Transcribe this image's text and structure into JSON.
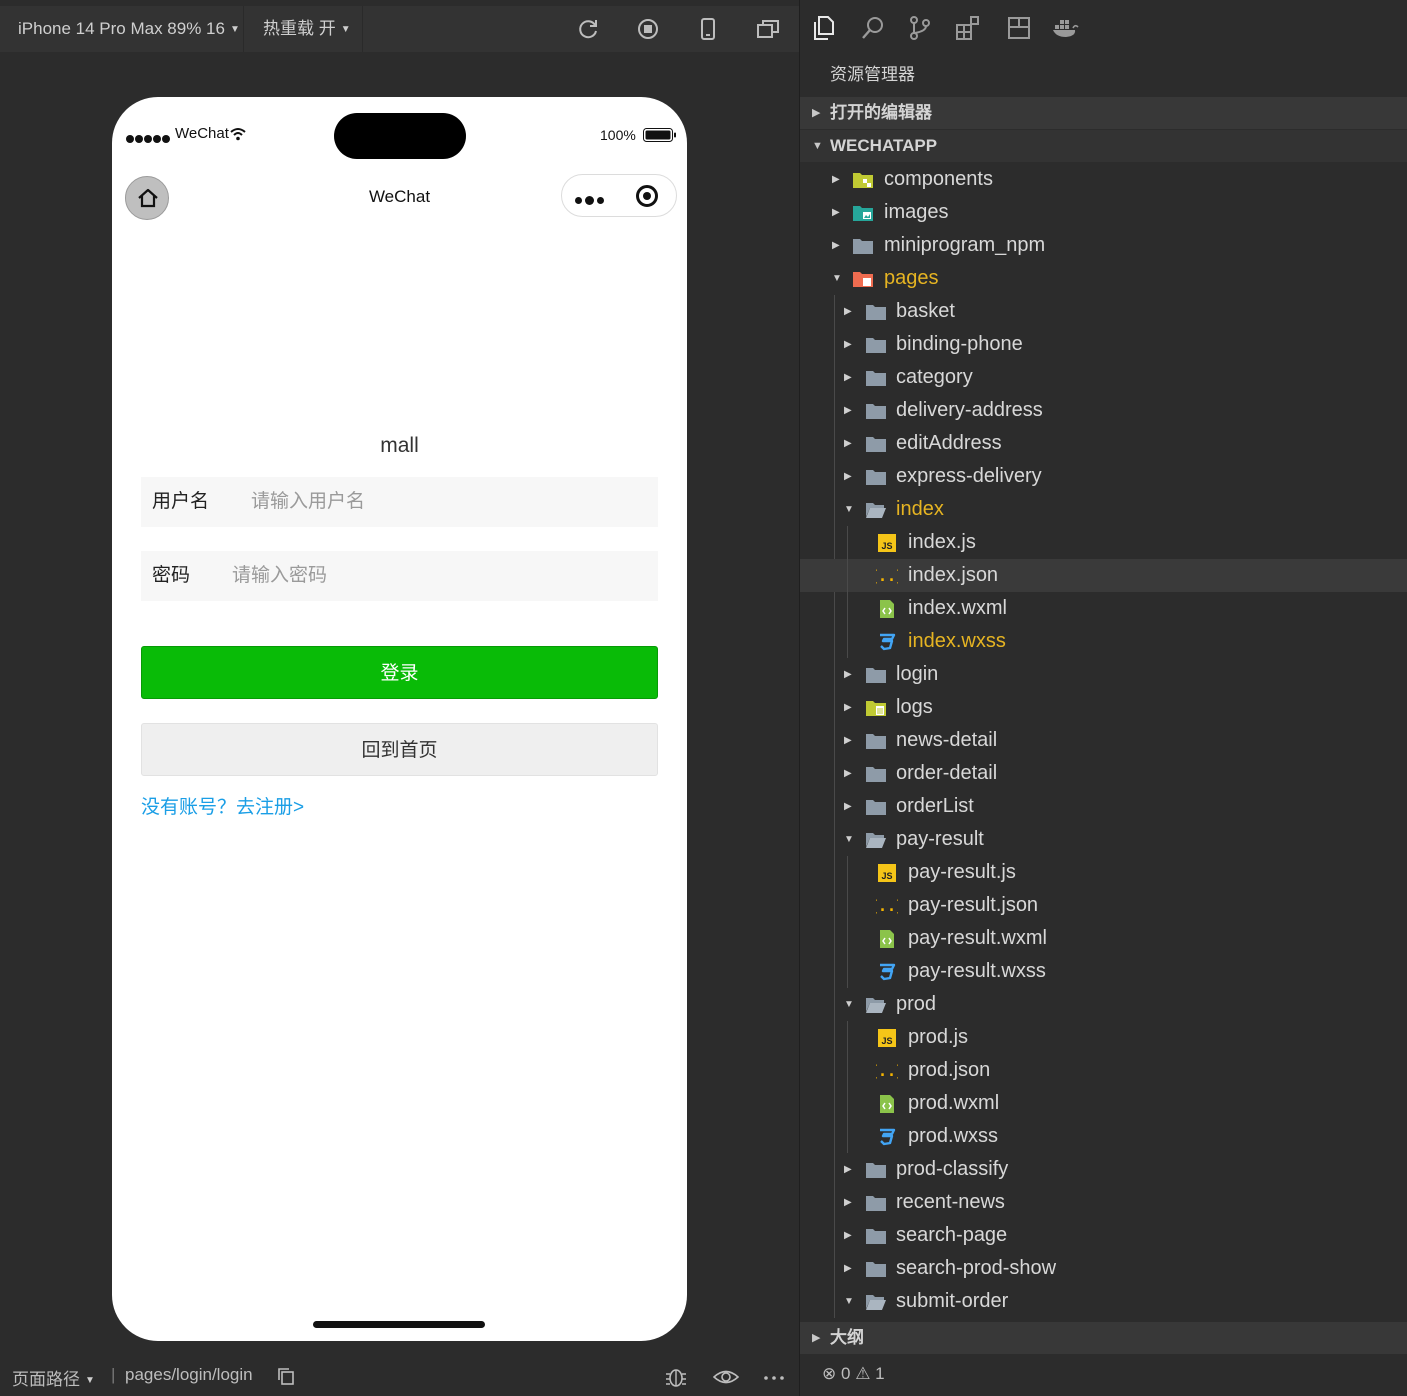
{
  "toolbar": {
    "device": "iPhone 14 Pro Max 89% 16",
    "hot_reload": "热重载 开",
    "icons": [
      "refresh-icon",
      "stop-icon",
      "device-icon",
      "detach-window-icon"
    ]
  },
  "phone": {
    "carrier": "WeChat",
    "battery": "100%",
    "nav_title": "WeChat",
    "app_title": "mall",
    "username_label": "用户名",
    "username_placeholder": "请输入用户名",
    "password_label": "密码",
    "password_placeholder": "请输入密码",
    "login_button": "登录",
    "home_button": "回到首页",
    "register_link": "没有账号？去注册>"
  },
  "bottombar": {
    "page_path_label": "页面路径",
    "separator": "|",
    "page_path": "pages/login/login"
  },
  "explorer": {
    "title": "资源管理器",
    "open_editors": "打开的编辑器",
    "project": "WECHATAPP",
    "outline": "大纲",
    "problems": {
      "errors": "0",
      "warnings": "1"
    },
    "tree": [
      {
        "label": "components",
        "depth": 0,
        "kind": "folder-components",
        "expanded": false
      },
      {
        "label": "images",
        "depth": 0,
        "kind": "folder-images",
        "expanded": false
      },
      {
        "label": "miniprogram_npm",
        "depth": 0,
        "kind": "folder",
        "expanded": false
      },
      {
        "label": "pages",
        "depth": 0,
        "kind": "folder-pages",
        "expanded": true,
        "highlight": true
      },
      {
        "label": "basket",
        "depth": 1,
        "kind": "folder",
        "expanded": false
      },
      {
        "label": "binding-phone",
        "depth": 1,
        "kind": "folder",
        "expanded": false
      },
      {
        "label": "category",
        "depth": 1,
        "kind": "folder",
        "expanded": false
      },
      {
        "label": "delivery-address",
        "depth": 1,
        "kind": "folder",
        "expanded": false
      },
      {
        "label": "editAddress",
        "depth": 1,
        "kind": "folder",
        "expanded": false
      },
      {
        "label": "express-delivery",
        "depth": 1,
        "kind": "folder",
        "expanded": false
      },
      {
        "label": "index",
        "depth": 1,
        "kind": "folder-open",
        "expanded": true,
        "highlight": true
      },
      {
        "label": "index.js",
        "depth": 2,
        "kind": "js"
      },
      {
        "label": "index.json",
        "depth": 2,
        "kind": "json",
        "selected": true
      },
      {
        "label": "index.wxml",
        "depth": 2,
        "kind": "wxml"
      },
      {
        "label": "index.wxss",
        "depth": 2,
        "kind": "wxss",
        "highlight": true
      },
      {
        "label": "login",
        "depth": 1,
        "kind": "folder",
        "expanded": false
      },
      {
        "label": "logs",
        "depth": 1,
        "kind": "folder-logs",
        "expanded": false
      },
      {
        "label": "news-detail",
        "depth": 1,
        "kind": "folder",
        "expanded": false
      },
      {
        "label": "order-detail",
        "depth": 1,
        "kind": "folder",
        "expanded": false
      },
      {
        "label": "orderList",
        "depth": 1,
        "kind": "folder",
        "expanded": false
      },
      {
        "label": "pay-result",
        "depth": 1,
        "kind": "folder-open",
        "expanded": true
      },
      {
        "label": "pay-result.js",
        "depth": 2,
        "kind": "js"
      },
      {
        "label": "pay-result.json",
        "depth": 2,
        "kind": "json"
      },
      {
        "label": "pay-result.wxml",
        "depth": 2,
        "kind": "wxml"
      },
      {
        "label": "pay-result.wxss",
        "depth": 2,
        "kind": "wxss"
      },
      {
        "label": "prod",
        "depth": 1,
        "kind": "folder-open",
        "expanded": true
      },
      {
        "label": "prod.js",
        "depth": 2,
        "kind": "js"
      },
      {
        "label": "prod.json",
        "depth": 2,
        "kind": "json"
      },
      {
        "label": "prod.wxml",
        "depth": 2,
        "kind": "wxml"
      },
      {
        "label": "prod.wxss",
        "depth": 2,
        "kind": "wxss"
      },
      {
        "label": "prod-classify",
        "depth": 1,
        "kind": "folder",
        "expanded": false
      },
      {
        "label": "recent-news",
        "depth": 1,
        "kind": "folder",
        "expanded": false
      },
      {
        "label": "search-page",
        "depth": 1,
        "kind": "folder",
        "expanded": false
      },
      {
        "label": "search-prod-show",
        "depth": 1,
        "kind": "folder",
        "expanded": false
      },
      {
        "label": "submit-order",
        "depth": 1,
        "kind": "folder-open",
        "expanded": true
      }
    ]
  },
  "colors": {
    "accent_green": "#09bb07",
    "link_blue": "#1a9ee6",
    "highlight_yellow": "#e6b422"
  }
}
